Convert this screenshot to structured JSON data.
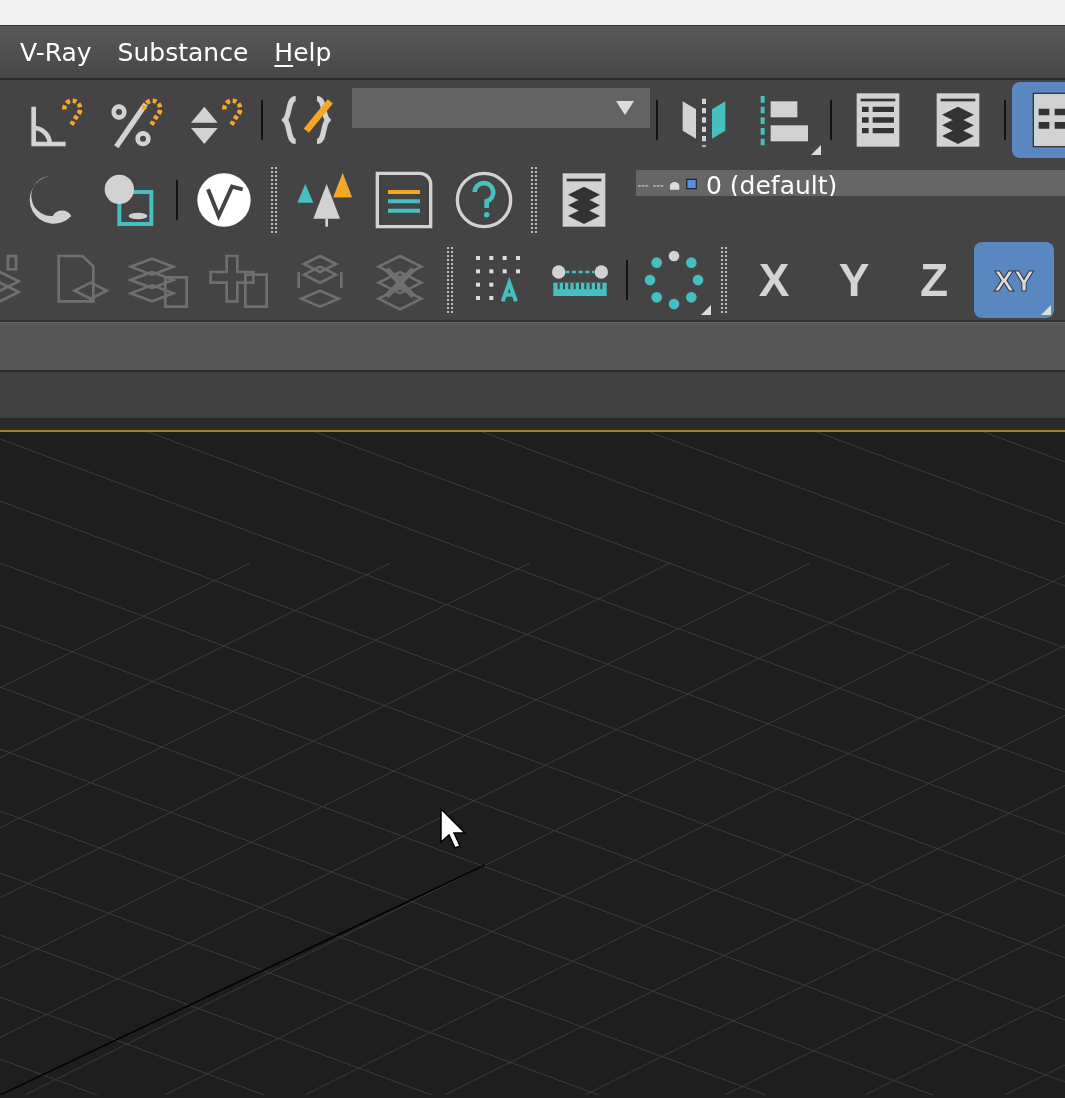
{
  "menu": [
    {
      "label": "V-Ray",
      "mnemonic": false
    },
    {
      "label": "Substance",
      "mnemonic": false
    },
    {
      "label": "Help",
      "mnemonic": true
    }
  ],
  "toolbars": [
    {
      "items": [
        {
          "kind": "tool",
          "selected": false,
          "disabled": false,
          "flyout": false
        },
        {
          "kind": "tool",
          "selected": false,
          "disabled": false,
          "flyout": false
        },
        {
          "kind": "tool",
          "selected": false,
          "disabled": false,
          "flyout": false
        },
        {
          "kind": "separator"
        },
        {
          "kind": "tool",
          "selected": false,
          "disabled": false,
          "flyout": false
        },
        {
          "kind": "dropdown"
        },
        {
          "kind": "separator"
        },
        {
          "kind": "tool",
          "selected": false,
          "disabled": false,
          "flyout": false
        },
        {
          "kind": "tool",
          "selected": false,
          "disabled": false,
          "flyout": true
        },
        {
          "kind": "separator"
        },
        {
          "kind": "tool",
          "selected": false,
          "disabled": false,
          "flyout": false
        },
        {
          "kind": "tool",
          "selected": false,
          "disabled": false,
          "flyout": false
        },
        {
          "kind": "separator"
        },
        {
          "kind": "tool",
          "selected": true,
          "disabled": false,
          "flyout": false
        }
      ]
    },
    {
      "items": [
        {
          "kind": "tool",
          "selected": false,
          "disabled": false,
          "flyout": false
        },
        {
          "kind": "tool",
          "selected": false,
          "disabled": false,
          "flyout": false
        },
        {
          "kind": "separator"
        },
        {
          "kind": "tool",
          "selected": false,
          "disabled": false,
          "flyout": false
        },
        {
          "kind": "grip"
        },
        {
          "kind": "tool",
          "selected": false,
          "disabled": false,
          "flyout": false
        },
        {
          "kind": "tool",
          "selected": false,
          "disabled": false,
          "flyout": false
        },
        {
          "kind": "tool",
          "selected": false,
          "disabled": false,
          "flyout": false
        },
        {
          "kind": "grip"
        },
        {
          "kind": "tool",
          "selected": false,
          "disabled": false,
          "flyout": false
        },
        {
          "kind": "layer",
          "value": "0 (default)"
        }
      ]
    },
    {
      "items": [
        {
          "kind": "tool",
          "selected": false,
          "disabled": true,
          "flyout": false
        },
        {
          "kind": "tool",
          "selected": false,
          "disabled": true,
          "flyout": false
        },
        {
          "kind": "tool",
          "selected": false,
          "disabled": true,
          "flyout": false
        },
        {
          "kind": "tool",
          "selected": false,
          "disabled": true,
          "flyout": false
        },
        {
          "kind": "tool",
          "selected": false,
          "disabled": true,
          "flyout": false
        },
        {
          "kind": "tool",
          "selected": false,
          "disabled": true,
          "flyout": false
        },
        {
          "kind": "grip"
        },
        {
          "kind": "tool",
          "selected": false,
          "disabled": false,
          "flyout": false
        },
        {
          "kind": "tool",
          "selected": false,
          "disabled": false,
          "flyout": false
        },
        {
          "kind": "separator"
        },
        {
          "kind": "tool",
          "selected": false,
          "disabled": false,
          "flyout": true
        },
        {
          "kind": "grip"
        },
        {
          "kind": "axis",
          "label": "X",
          "selected": false,
          "flyout": false
        },
        {
          "kind": "axis",
          "label": "Y",
          "selected": false,
          "flyout": false
        },
        {
          "kind": "axis",
          "label": "Z",
          "selected": false,
          "flyout": false
        },
        {
          "kind": "axis",
          "label": "XY",
          "selected": true,
          "flyout": true
        }
      ]
    }
  ]
}
